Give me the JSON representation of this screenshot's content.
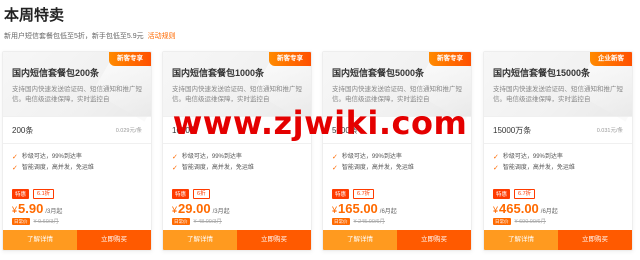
{
  "header": {
    "title": "本周特卖",
    "subtitle": "新用户短信套餐包低至5折，新手包低至5.9元",
    "rules_link": "活动规则"
  },
  "cards": [
    {
      "ribbon": "新客专享",
      "title": "国内短信套餐包200条",
      "desc": "支持国内快速发送验证码、短信通知和推广短信。电信级运维保障，实时监控自",
      "spec_qty": "200条",
      "spec_unit": "0.029元/条",
      "features": [
        "秒级可达，99%到达率",
        "智能调度，高并发，免运维"
      ],
      "tag_special": "特惠",
      "tag_discount": "6.1折",
      "currency": "¥",
      "price": "5.90",
      "period": "/3月起",
      "tag_orig": "日常价",
      "orig_price": "¥ 9.60/3月"
    },
    {
      "ribbon": "新客专享",
      "title": "国内短信套餐包1000条",
      "desc": "支持国内快速发送验证码、短信通知和推广短信。电信级运维保障，实时监控自",
      "spec_qty": "1000条",
      "spec_unit": "",
      "features": [
        "秒级可达，99%到达率",
        "智能调度，高并发，免运维"
      ],
      "tag_special": "特惠",
      "tag_discount": "6折",
      "currency": "¥",
      "price": "29.00",
      "period": "/3月起",
      "tag_orig": "日常价",
      "orig_price": "¥ 48.00/3月"
    },
    {
      "ribbon": "新客专享",
      "title": "国内短信套餐包5000条",
      "desc": "支持国内快速发送验证码、短信通知和推广短信。电信级运维保障，实时监控自",
      "spec_qty": "5000条",
      "spec_unit": "",
      "features": [
        "秒级可达，99%到达率",
        "智能调度，高并发，免运维"
      ],
      "tag_special": "特惠",
      "tag_discount": "6.7折",
      "currency": "¥",
      "price": "165.00",
      "period": "/6月起",
      "tag_orig": "日常价",
      "orig_price": "¥ 245.00/6月"
    },
    {
      "ribbon": "企业新客",
      "title": "国内短信套餐包15000条",
      "desc": "支持国内快速发送验证码、短信通知和推广短信。电信级运维保障，实时监控自",
      "spec_qty": "15000万条",
      "spec_unit": "0.031元/条",
      "features": [
        "秒级可达，99%到达率",
        "智能调度，高并发，免运维"
      ],
      "tag_special": "特惠",
      "tag_discount": "6.7折",
      "currency": "¥",
      "price": "465.00",
      "period": "/6月起",
      "tag_orig": "日常价",
      "orig_price": "¥ 690.00/6月"
    }
  ],
  "buttons": {
    "details": "了解详情",
    "buy": "立即购买"
  },
  "watermark": "www.zjwiki.com",
  "colors": {
    "accent": "#ff6a00",
    "buy_button": "#ff5a00",
    "details_button": "#ff9a1f",
    "watermark": "#e40000"
  }
}
